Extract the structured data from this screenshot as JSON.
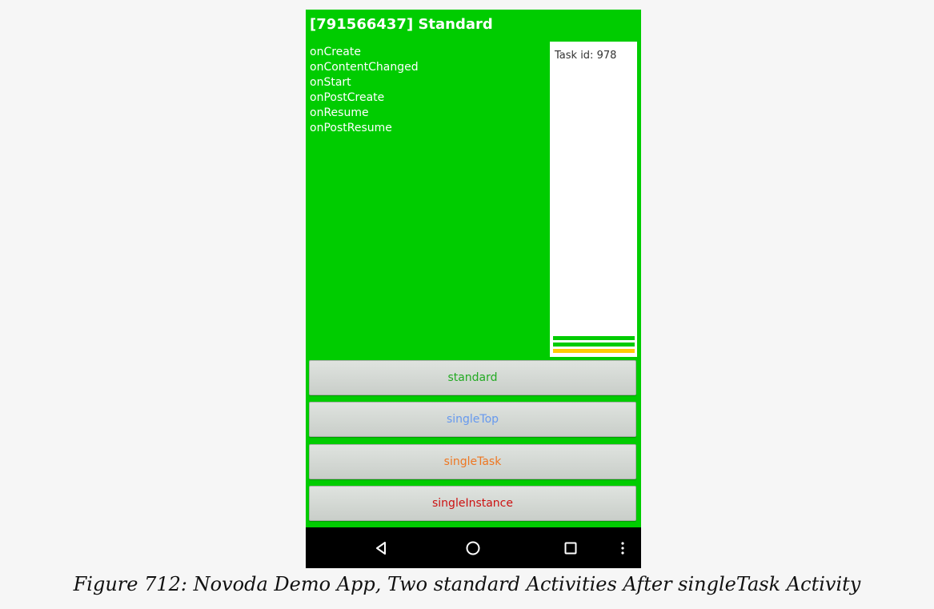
{
  "app": {
    "title": "[791566437] Standard",
    "lifecycle_events": [
      "onCreate",
      "onContentChanged",
      "onStart",
      "onPostCreate",
      "onResume",
      "onPostResume"
    ],
    "task_label": "Task id: 978",
    "task_stack_colors": [
      "#00cc00",
      "#00cc00",
      "#ffcc00"
    ],
    "background_color": "#00cc00"
  },
  "buttons": [
    {
      "label": "standard",
      "color": "#22aa22"
    },
    {
      "label": "singleTop",
      "color": "#6699ee"
    },
    {
      "label": "singleTask",
      "color": "#ee7722"
    },
    {
      "label": "singleInstance",
      "color": "#cc1111"
    }
  ],
  "navbar": {
    "icons": [
      "back-icon",
      "home-icon",
      "recents-icon",
      "overflow-menu-icon"
    ]
  },
  "caption": "Figure 712: Novoda Demo App, Two standard Activities After singleTask Activity"
}
